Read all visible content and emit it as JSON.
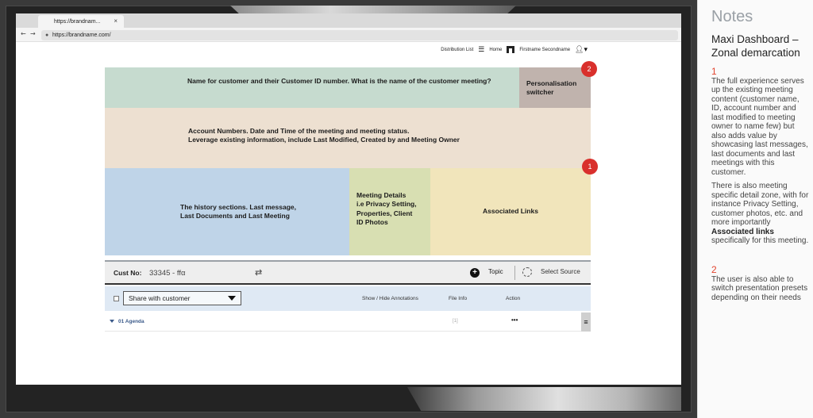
{
  "browser": {
    "tab_title": "https://brandnam...",
    "tab_close": "×",
    "back": "←",
    "forward": "→",
    "url": "https://brandname.com/"
  },
  "topnav": {
    "distribution": "Distribution List",
    "home": "Home",
    "user": "Firstname Secondname"
  },
  "zones": {
    "name": "Name for customer and their Customer ID number. What is the name of the customer meeting?",
    "personalisation": "Personalisation switcher",
    "account_line1": "Account Numbers. Date and Time of the meeting and meeting status.",
    "account_line2": "Leverage existing information, include Last Modified, Created by and Meeting Owner",
    "history_line1": "The history sections. Last message,",
    "history_line2": "Last Documents and Last Meeting",
    "details_line1": "Meeting Details",
    "details_line2": "i.e Privacy Setting,",
    "details_line3": "Properties, Client",
    "details_line4": "ID Photos",
    "links": "Associated Links"
  },
  "badges": {
    "two": "2",
    "one": "1"
  },
  "custbar": {
    "label": "Cust No:",
    "value": "33345 - ffα",
    "topic": "Topic",
    "select_source": "Select Source"
  },
  "table": {
    "share_select": "Share with customer",
    "col_annotations": "Show / Hide Annotations",
    "col_fileinfo": "File Info",
    "col_action": "Action",
    "row_name": "01 Agenda",
    "row_info": "[1]",
    "row_action": "•••",
    "row_handle": "≡"
  },
  "notes": {
    "heading": "Notes",
    "title": "Maxi Dashboard – Zonal demarcation",
    "n1": "1",
    "p1": "The full experience serves up the existing meeting content (customer name, ID, account number and last modified to meeting owner to name few) but also adds value by showcasing last messages, last documents and last meetings with this customer.",
    "p2a": "There is also meeting specific detail zone, with for instance Privacy Setting, customer photos, etc. and more importantly",
    "p2b": "Associated links",
    "p2c": "specifically for this meeting.",
    "n2": "2",
    "p3": "The user is also able to switch presentation presets depending on their needs"
  }
}
